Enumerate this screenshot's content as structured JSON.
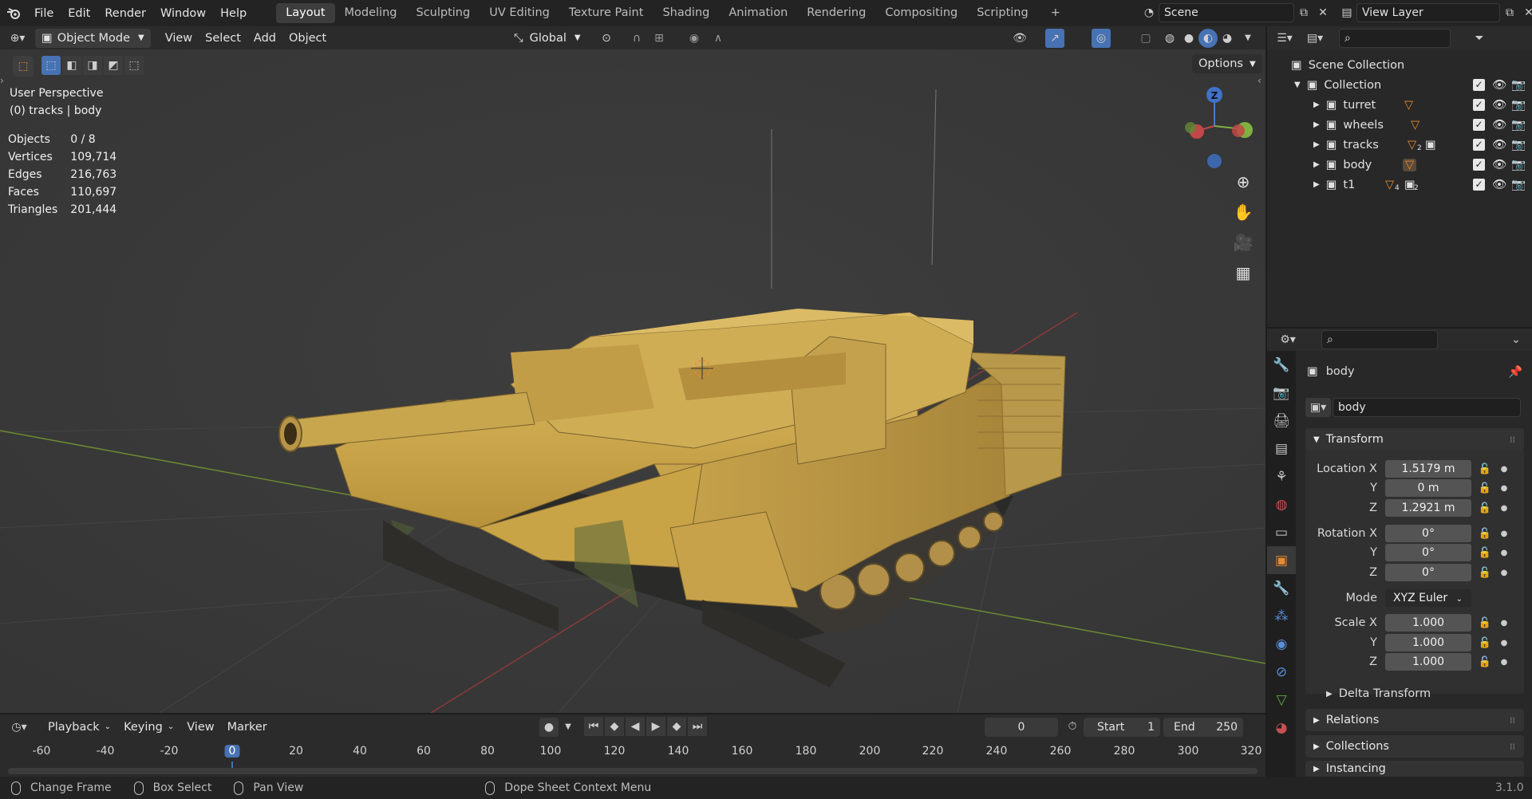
{
  "topbar": {
    "menu": [
      "File",
      "Edit",
      "Render",
      "Window",
      "Help"
    ],
    "workspaces": [
      "Layout",
      "Modeling",
      "Sculpting",
      "UV Editing",
      "Texture Paint",
      "Shading",
      "Animation",
      "Rendering",
      "Compositing",
      "Scripting"
    ],
    "active_workspace": "Layout",
    "scene": "Scene",
    "view_layer": "View Layer"
  },
  "viewport_header": {
    "mode": "Object Mode",
    "menus": [
      "View",
      "Select",
      "Add",
      "Object"
    ],
    "orientation": "Global",
    "options": "Options"
  },
  "overlay": {
    "perspective": "User Perspective",
    "context": "(0) tracks | body",
    "stats": [
      {
        "label": "Objects",
        "value": "0 / 8"
      },
      {
        "label": "Vertices",
        "value": "109,714"
      },
      {
        "label": "Edges",
        "value": "216,763"
      },
      {
        "label": "Faces",
        "value": "110,697"
      },
      {
        "label": "Triangles",
        "value": "201,444"
      }
    ]
  },
  "gizmo": {
    "z": "Z"
  },
  "outliner": {
    "root": "Scene Collection",
    "collection": "Collection",
    "items": [
      {
        "name": "turret",
        "badge": ""
      },
      {
        "name": "wheels",
        "badge": ""
      },
      {
        "name": "tracks",
        "badge": "2"
      },
      {
        "name": "body",
        "badge": ""
      },
      {
        "name": "t1",
        "badge": "4",
        "badge2": "2"
      }
    ]
  },
  "properties": {
    "object_name": "body",
    "data_name": "body",
    "transform_title": "Transform",
    "location": {
      "label": "Location X",
      "x": "1.5179 m",
      "y": "0 m",
      "z": "1.2921 m"
    },
    "rotation": {
      "label": "Rotation X",
      "x": "0°",
      "y": "0°",
      "z": "0°"
    },
    "mode_label": "Mode",
    "mode_value": "XYZ Euler",
    "scale": {
      "label": "Scale X",
      "x": "1.000",
      "y": "1.000",
      "z": "1.000"
    },
    "axis_y": "Y",
    "axis_z": "Z",
    "sections": [
      "Delta Transform",
      "Relations",
      "Collections",
      "Instancing"
    ]
  },
  "timeline": {
    "menus": [
      "Playback",
      "Keying",
      "View",
      "Marker"
    ],
    "current_frame": "0",
    "start_label": "Start",
    "start": "1",
    "end_label": "End",
    "end": "250",
    "ruler": [
      "-60",
      "-40",
      "-20",
      "0",
      "20",
      "40",
      "60",
      "80",
      "100",
      "120",
      "140",
      "160",
      "180",
      "200",
      "220",
      "240",
      "260",
      "280",
      "300",
      "320"
    ]
  },
  "status": {
    "items": [
      "Change Frame",
      "Box Select",
      "Pan View",
      "Dope Sheet Context Menu"
    ],
    "version": "3.1.0"
  },
  "colors": {
    "accent": "#4772b3",
    "object_orange": "#e88a2e",
    "tank": "#c9a646"
  }
}
